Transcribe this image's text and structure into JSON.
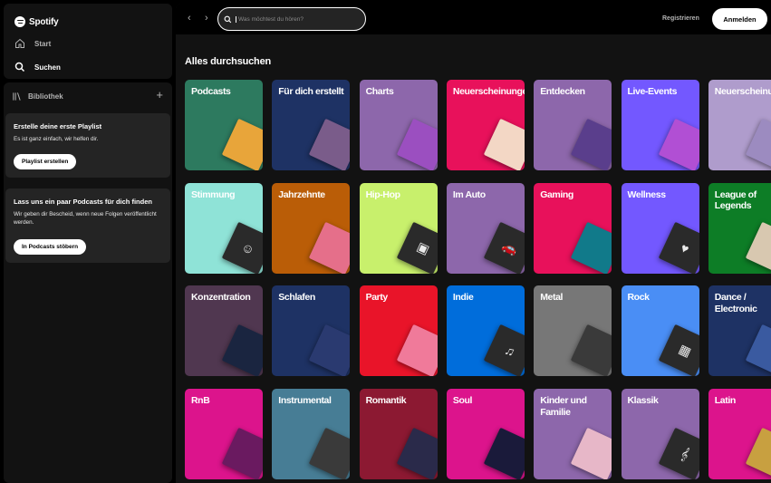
{
  "sidebar": {
    "logo_text": "Spotify",
    "nav": [
      {
        "label": "Start",
        "active": false
      },
      {
        "label": "Suchen",
        "active": true
      }
    ],
    "library_label": "Bibliothek",
    "add_symbol": "+",
    "cards": [
      {
        "title": "Erstelle deine erste Playlist",
        "text": "Es ist ganz einfach, wir helfen dir.",
        "button": "Playlist erstellen"
      },
      {
        "title": "Lass uns ein paar Podcasts für dich finden",
        "text": "Wir geben dir Bescheid, wenn neue Folgen veröffentlicht werden.",
        "button": "In Podcasts stöbern"
      }
    ]
  },
  "topbar": {
    "back_glyph": "‹",
    "forward_glyph": "›",
    "search_placeholder": "Was möchtest du hören?",
    "register_label": "Registrieren",
    "login_label": "Anmelden"
  },
  "main": {
    "section_title": "Alles durchsuchen",
    "tiles": [
      {
        "label": "Podcasts",
        "bg": "#2d7a5f",
        "art": "#e8a53a",
        "glyph": ""
      },
      {
        "label": "Für dich erstellt",
        "bg": "#1e3264",
        "art": "#7a5c8a",
        "glyph": ""
      },
      {
        "label": "Charts",
        "bg": "#8d67ab",
        "art": "#9b4fc0",
        "glyph": ""
      },
      {
        "label": "Neuerscheinungen",
        "bg": "#e8115b",
        "art": "#f3d7c5",
        "glyph": ""
      },
      {
        "label": "Entdecken",
        "bg": "#8d67ab",
        "art": "#5a3e8c",
        "glyph": ""
      },
      {
        "label": "Live-Events",
        "bg": "#7358ff",
        "art": "#b14fd4",
        "glyph": ""
      },
      {
        "label": "Neuerscheinungen",
        "bg": "#af9ccc",
        "art": "#9c8bc0",
        "glyph": ""
      },
      {
        "label": "Stimmung",
        "bg": "#8fe3d7",
        "art": "#2a2a2a",
        "glyph": "☺"
      },
      {
        "label": "Jahrzehnte",
        "bg": "#ba5d07",
        "art": "#e56f8a",
        "glyph": ""
      },
      {
        "label": "Hip-Hop",
        "bg": "#c8f06c",
        "art": "#2a2a2a",
        "glyph": "▣"
      },
      {
        "label": "Im Auto",
        "bg": "#8d67ab",
        "art": "#2a2a2a",
        "glyph": "🚗"
      },
      {
        "label": "Gaming",
        "bg": "#e8115b",
        "art": "#117a8a",
        "glyph": ""
      },
      {
        "label": "Wellness",
        "bg": "#7358ff",
        "art": "#2a2a2a",
        "glyph": "♥"
      },
      {
        "label": "League of Legends",
        "bg": "#0d7d26",
        "art": "#d8c8b0",
        "glyph": ""
      },
      {
        "label": "Konzentration",
        "bg": "#503750",
        "art": "#1a2540",
        "glyph": ""
      },
      {
        "label": "Schlafen",
        "bg": "#1e3264",
        "art": "#2a3a70",
        "glyph": ""
      },
      {
        "label": "Party",
        "bg": "#e91429",
        "art": "#f07a9a",
        "glyph": ""
      },
      {
        "label": "Indie",
        "bg": "#006ddb",
        "art": "#2a2a2a",
        "glyph": "♫"
      },
      {
        "label": "Metal",
        "bg": "#777777",
        "art": "#3a3a3a",
        "glyph": ""
      },
      {
        "label": "Rock",
        "bg": "#4a8ef5",
        "art": "#2a2a2a",
        "glyph": "▦"
      },
      {
        "label": "Dance / Electronic",
        "bg": "#1e3264",
        "art": "#3a5aa0",
        "glyph": ""
      },
      {
        "label": "RnB",
        "bg": "#dc148c",
        "art": "#6a1a60",
        "glyph": ""
      },
      {
        "label": "Instrumental",
        "bg": "#477d95",
        "art": "#3a3a3a",
        "glyph": ""
      },
      {
        "label": "Romantik",
        "bg": "#8c1932",
        "art": "#2a2a4a",
        "glyph": ""
      },
      {
        "label": "Soul",
        "bg": "#dc148c",
        "art": "#1a1a3a",
        "glyph": ""
      },
      {
        "label": "Kinder und Familie",
        "bg": "#8d67ab",
        "art": "#e7b7c8",
        "glyph": ""
      },
      {
        "label": "Klassik",
        "bg": "#8d67ab",
        "art": "#2a2a2a",
        "glyph": "𝄞"
      },
      {
        "label": "Latin",
        "bg": "#dc148c",
        "art": "#c8a040",
        "glyph": ""
      }
    ]
  }
}
